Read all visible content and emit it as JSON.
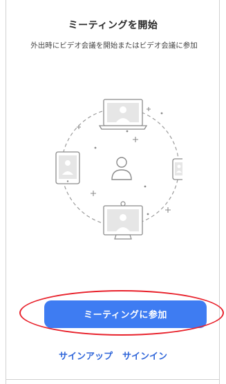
{
  "header": {
    "title": "ミーティングを開始",
    "subtitle": "外出時にビデオ会議を開始またはビデオ会議に参加"
  },
  "illustration": {
    "icons": [
      "laptop-icon",
      "tablet-icon",
      "phone-icon",
      "user-icon",
      "desktop-monitor-icon"
    ]
  },
  "actions": {
    "join_label": "ミーティングに参加",
    "signup_label": "サインアップ",
    "signin_label": "サインイン"
  },
  "colors": {
    "primary": "#3e7cf2",
    "link": "#3066d9",
    "highlight": "#e8212b"
  }
}
